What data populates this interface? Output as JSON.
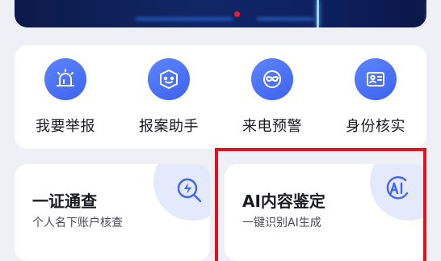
{
  "tools": [
    {
      "label": "我要举报",
      "icon": "alarm-siren-icon"
    },
    {
      "label": "报案助手",
      "icon": "robot-assistant-icon"
    },
    {
      "label": "来电预警",
      "icon": "masked-caller-icon"
    },
    {
      "label": "身份核实",
      "icon": "id-card-icon"
    }
  ],
  "cards": [
    {
      "title": "一证通查",
      "subtitle": "个人名下账户核查",
      "icon": "search-lightning-icon"
    },
    {
      "title": "AI内容鉴定",
      "subtitle": "一键识别AI生成",
      "icon": "ai-badge-icon"
    }
  ],
  "colors": {
    "accent": "#3f66f0",
    "highlight": "#e8101c",
    "banner": "#0e2163"
  }
}
